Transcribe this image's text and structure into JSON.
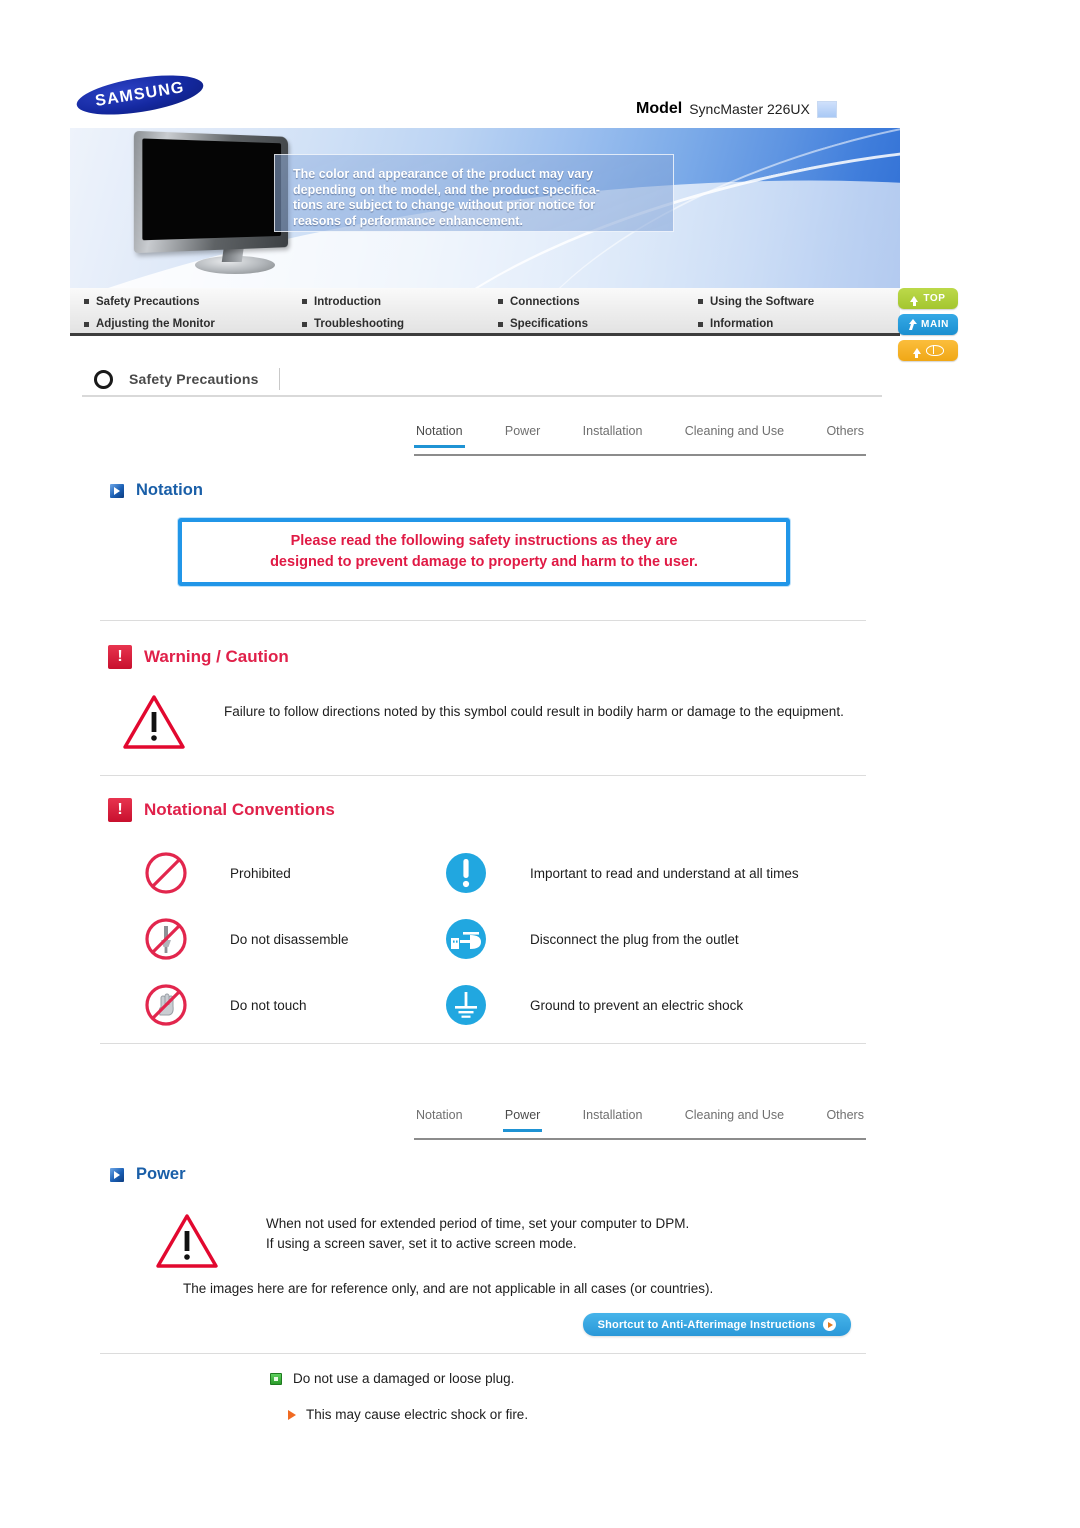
{
  "brand": {
    "logo_text": "SAMSUNG"
  },
  "model": {
    "label": "Model",
    "value": "SyncMaster 226UX"
  },
  "banner": {
    "note_line1": "The color and appearance of the product may vary",
    "note_line2": "depending on the model, and the product specifica-",
    "note_line3": "tions are subject to change without prior notice for",
    "note_line4": "reasons of performance enhancement."
  },
  "nav": {
    "items": [
      "Safety Precautions",
      "Introduction",
      "Connections",
      "Using the Software",
      "Adjusting the Monitor",
      "Troubleshooting",
      "Specifications",
      "Information"
    ]
  },
  "side_buttons": [
    {
      "label": "TOP",
      "icon": "arrow-up-icon",
      "color": "#aecb35"
    },
    {
      "label": "MAIN",
      "icon": "home-arrow-icon",
      "color": "#1f9bdb"
    },
    {
      "label": "",
      "icon": "arrow-up-book-icon",
      "color": "#f5ae22"
    }
  ],
  "section": {
    "title": "Safety Precautions"
  },
  "tabs_top": {
    "items": [
      "Notation",
      "Power",
      "Installation",
      "Cleaning and Use",
      "Others"
    ],
    "active": "Notation"
  },
  "tabs_bottom": {
    "items": [
      "Notation",
      "Power",
      "Installation",
      "Cleaning and Use",
      "Others"
    ],
    "active": "Power"
  },
  "notation": {
    "heading": "Notation",
    "notice_line1": "Please read the following safety instructions as they are",
    "notice_line2": "designed to prevent damage to property and harm to the user.",
    "notice_color": "#e01a45",
    "border_color": "#2196e8"
  },
  "warning": {
    "heading": "Warning / Caution",
    "text": "Failure to follow directions noted by this symbol could result in bodily harm or damage to the equipment."
  },
  "conventions": {
    "heading": "Notational Conventions",
    "rows": [
      {
        "left_icon": "prohibited-icon",
        "left_label": "Prohibited",
        "right_icon": "important-exclamation-icon",
        "right_label": "Important to read and understand at all times"
      },
      {
        "left_icon": "do-not-disassemble-icon",
        "left_label": "Do not disassemble",
        "right_icon": "disconnect-plug-icon",
        "right_label": "Disconnect the plug from the outlet"
      },
      {
        "left_icon": "do-not-touch-icon",
        "left_label": "Do not touch",
        "right_icon": "ground-icon",
        "right_label": "Ground to prevent an electric shock"
      }
    ]
  },
  "power": {
    "heading": "Power",
    "warn_line1": "When not used for extended period of time, set your computer to DPM.",
    "warn_line2": "If using a screen saver, set it to active screen mode.",
    "reference_note": "The images here are for reference only, and are not applicable in all cases (or countries).",
    "shortcut_label": "Shortcut to Anti-Afterimage Instructions",
    "bullet_main": "Do not use a damaged or loose plug.",
    "bullet_sub": "This may cause electric shock or fire."
  }
}
